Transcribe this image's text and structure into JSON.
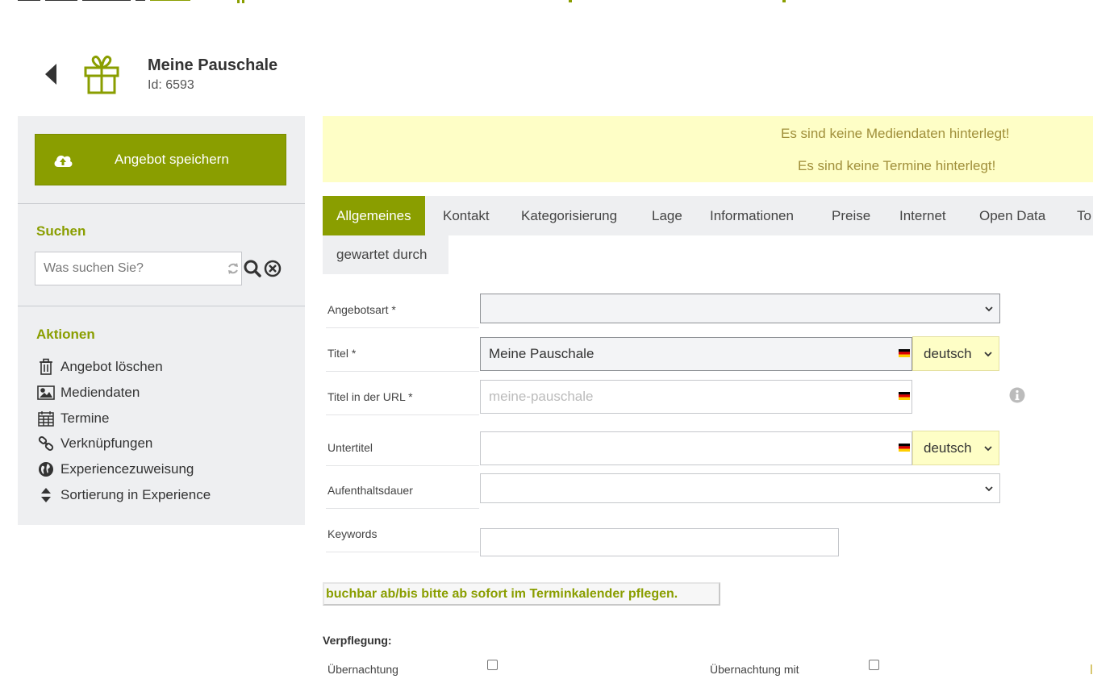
{
  "header": {
    "title": "Meine Pauschale",
    "id_label": "Id: 6593"
  },
  "sidebar": {
    "save_label": "Angebot speichern",
    "search_title": "Suchen",
    "search_placeholder": "Was suchen Sie?",
    "actions_title": "Aktionen",
    "actions": [
      {
        "label": "Angebot löschen",
        "icon": "trash-icon"
      },
      {
        "label": "Mediendaten",
        "icon": "image-icon"
      },
      {
        "label": "Termine",
        "icon": "calendar-icon"
      },
      {
        "label": "Verknüpfungen",
        "icon": "link-icon"
      },
      {
        "label": "Experiencezuweisung",
        "icon": "globe-icon"
      },
      {
        "label": "Sortierung in Experience",
        "icon": "sort-icon"
      }
    ]
  },
  "notices": [
    "Es sind keine Mediendaten hinterlegt!",
    "Es sind keine Termine hinterlegt!"
  ],
  "tabs": [
    {
      "label": "Allgemeines",
      "active": true
    },
    {
      "label": "Kontakt"
    },
    {
      "label": "Kategorisierung"
    },
    {
      "label": "Lage"
    },
    {
      "label": "Informationen"
    },
    {
      "label": "Preise"
    },
    {
      "label": "Internet"
    },
    {
      "label": "Open Data"
    },
    {
      "label": "To"
    },
    {
      "label": "gewartet durch"
    }
  ],
  "form": {
    "angebotsart_label": "Angebotsart *",
    "angebotsart_value": "",
    "titel_label": "Titel *",
    "titel_value": "Meine Pauschale",
    "titel_lang": "deutsch",
    "url_label": "Titel in der URL *",
    "url_placeholder": "meine-pauschale",
    "untertitel_label": "Untertitel",
    "untertitel_value": "",
    "untertitel_lang": "deutsch",
    "aufenthalt_label": "Aufenthaltsdauer",
    "aufenthalt_value": "",
    "keywords_label": "Keywords",
    "keywords_value": ""
  },
  "note_button": "buchbar ab/bis bitte ab sofort im Terminkalender pflegen.",
  "verpflegung": {
    "title": "Verpflegung:",
    "options": [
      "Übernachtung",
      "Übernachtung mit"
    ]
  },
  "colors": {
    "brand_green": "#8a9e00",
    "notice_bg": "#fefec6",
    "notice_text": "#a08f3a",
    "sidebar_bg": "#eeeff1"
  }
}
